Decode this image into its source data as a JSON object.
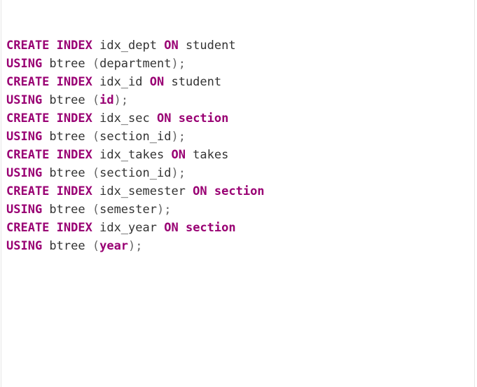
{
  "colors": {
    "keyword": "#990073",
    "identifier": "#333333",
    "punctuation": "#666666",
    "background": "#ffffff"
  },
  "code": {
    "lines": [
      [
        {
          "t": "CREATE",
          "k": "kw"
        },
        {
          "t": " ",
          "k": "plain"
        },
        {
          "t": "INDEX",
          "k": "kw"
        },
        {
          "t": " idx_dept ",
          "k": "plain"
        },
        {
          "t": "ON",
          "k": "kw"
        },
        {
          "t": " student",
          "k": "plain"
        }
      ],
      [
        {
          "t": "USING",
          "k": "kw"
        },
        {
          "t": " btree ",
          "k": "plain"
        },
        {
          "t": "(",
          "k": "punct"
        },
        {
          "t": "department",
          "k": "plain"
        },
        {
          "t": ");",
          "k": "punct"
        }
      ],
      [
        {
          "t": "CREATE",
          "k": "kw"
        },
        {
          "t": " ",
          "k": "plain"
        },
        {
          "t": "INDEX",
          "k": "kw"
        },
        {
          "t": " idx_id ",
          "k": "plain"
        },
        {
          "t": "ON",
          "k": "kw"
        },
        {
          "t": " student",
          "k": "plain"
        }
      ],
      [
        {
          "t": "USING",
          "k": "kw"
        },
        {
          "t": " btree ",
          "k": "plain"
        },
        {
          "t": "(",
          "k": "punct"
        },
        {
          "t": "id",
          "k": "kw"
        },
        {
          "t": ");",
          "k": "punct"
        }
      ],
      [
        {
          "t": "CREATE",
          "k": "kw"
        },
        {
          "t": " ",
          "k": "plain"
        },
        {
          "t": "INDEX",
          "k": "kw"
        },
        {
          "t": " idx_sec ",
          "k": "plain"
        },
        {
          "t": "ON",
          "k": "kw"
        },
        {
          "t": " ",
          "k": "plain"
        },
        {
          "t": "section",
          "k": "kw"
        }
      ],
      [
        {
          "t": "USING",
          "k": "kw"
        },
        {
          "t": " btree ",
          "k": "plain"
        },
        {
          "t": "(",
          "k": "punct"
        },
        {
          "t": "section_id",
          "k": "plain"
        },
        {
          "t": ");",
          "k": "punct"
        }
      ],
      [
        {
          "t": "CREATE",
          "k": "kw"
        },
        {
          "t": " ",
          "k": "plain"
        },
        {
          "t": "INDEX",
          "k": "kw"
        },
        {
          "t": " idx_takes ",
          "k": "plain"
        },
        {
          "t": "ON",
          "k": "kw"
        },
        {
          "t": " takes",
          "k": "plain"
        }
      ],
      [
        {
          "t": "USING",
          "k": "kw"
        },
        {
          "t": " btree ",
          "k": "plain"
        },
        {
          "t": "(",
          "k": "punct"
        },
        {
          "t": "section_id",
          "k": "plain"
        },
        {
          "t": ");",
          "k": "punct"
        }
      ],
      [
        {
          "t": "CREATE",
          "k": "kw"
        },
        {
          "t": " ",
          "k": "plain"
        },
        {
          "t": "INDEX",
          "k": "kw"
        },
        {
          "t": " idx_semester ",
          "k": "plain"
        },
        {
          "t": "ON",
          "k": "kw"
        },
        {
          "t": " ",
          "k": "plain"
        },
        {
          "t": "section",
          "k": "kw"
        }
      ],
      [
        {
          "t": "USING",
          "k": "kw"
        },
        {
          "t": " btree ",
          "k": "plain"
        },
        {
          "t": "(",
          "k": "punct"
        },
        {
          "t": "semester",
          "k": "plain"
        },
        {
          "t": ");",
          "k": "punct"
        }
      ],
      [
        {
          "t": "CREATE",
          "k": "kw"
        },
        {
          "t": " ",
          "k": "plain"
        },
        {
          "t": "INDEX",
          "k": "kw"
        },
        {
          "t": " idx_year ",
          "k": "plain"
        },
        {
          "t": "ON",
          "k": "kw"
        },
        {
          "t": " ",
          "k": "plain"
        },
        {
          "t": "section",
          "k": "kw"
        }
      ],
      [
        {
          "t": "USING",
          "k": "kw"
        },
        {
          "t": " btree ",
          "k": "plain"
        },
        {
          "t": "(",
          "k": "punct"
        },
        {
          "t": "year",
          "k": "kw"
        },
        {
          "t": ");",
          "k": "punct"
        }
      ]
    ]
  }
}
